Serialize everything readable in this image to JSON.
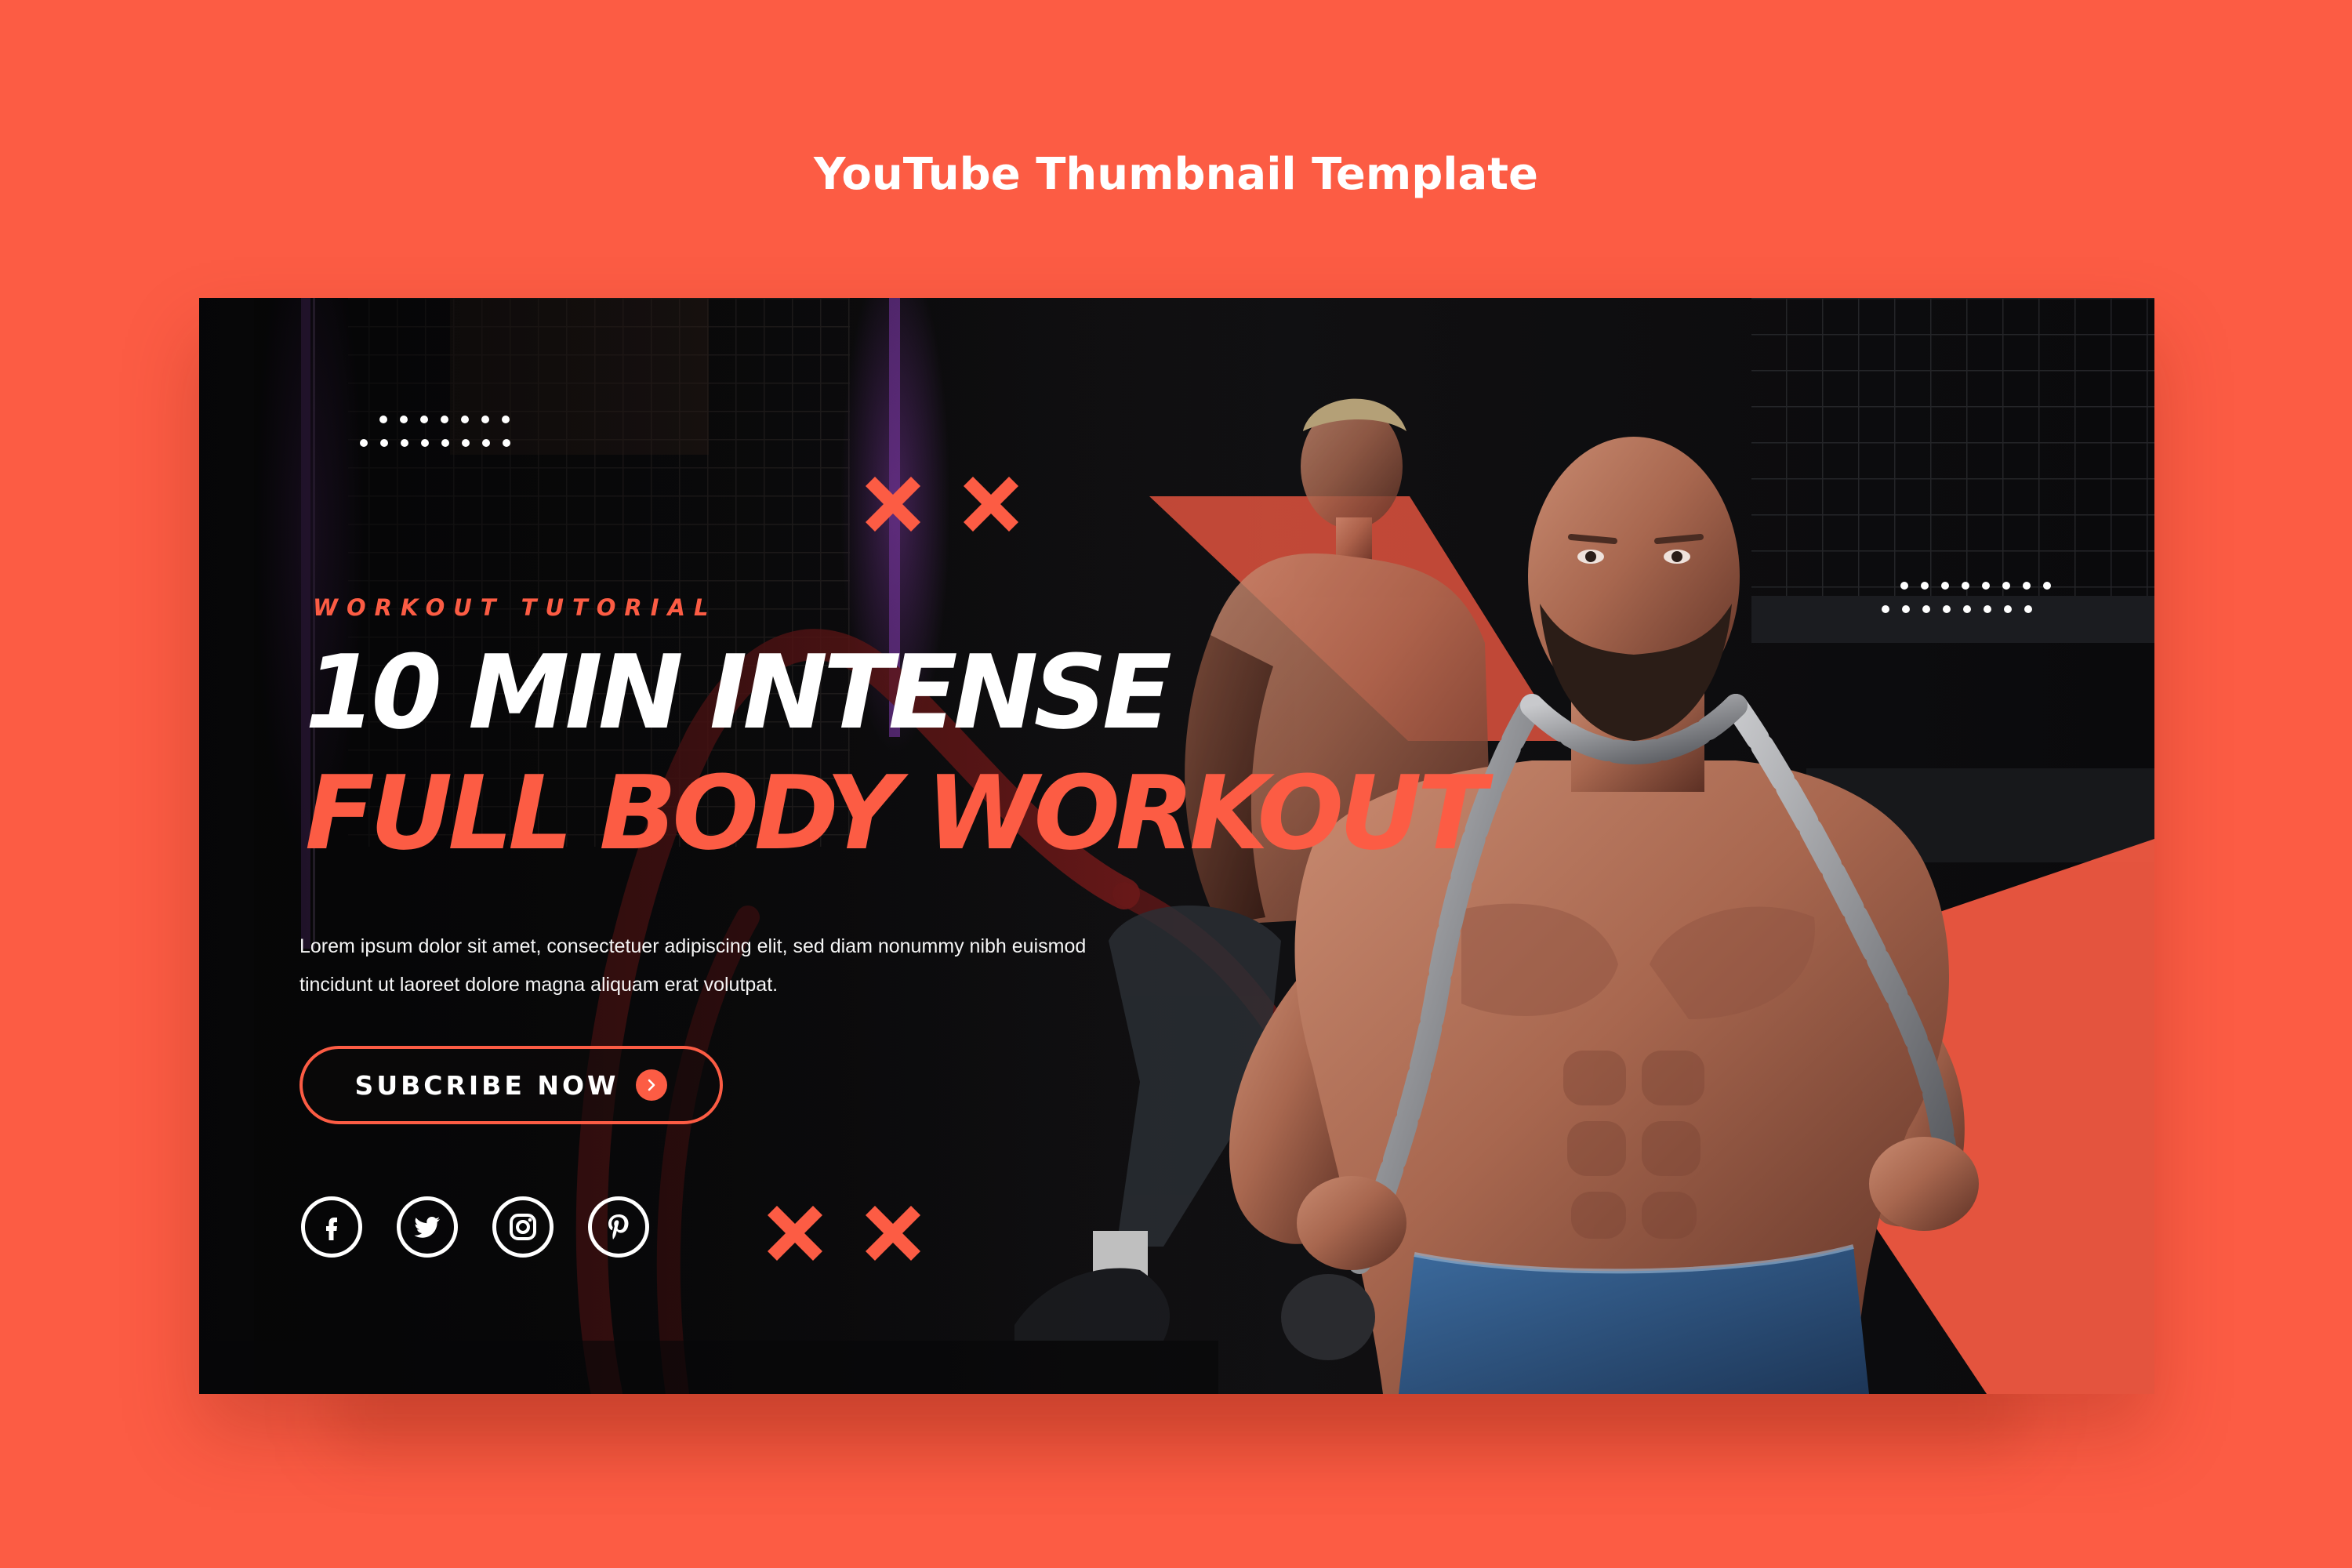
{
  "page": {
    "title": "YouTube Thumbnail Template",
    "background_color": "#fc5c44"
  },
  "thumbnail": {
    "eyebrow": "WORKOUT TUTORIAL",
    "headline_line_1": "10 MIN INTENSE",
    "headline_line_2": "FULL BODY WORKOUT",
    "body": "Lorem ipsum dolor sit amet, consectetuer adipiscing elit, sed diam nonummy nibh euismod tincidunt ut laoreet dolore magna aliquam erat volutpat.",
    "cta_label": "SUBCRIBE NOW",
    "cta_icon": "chevron-right-icon",
    "accent_color": "#fc5c44",
    "dark_color": "#0b0b0d",
    "social_icons": [
      "facebook-icon",
      "twitter-icon",
      "instagram-icon",
      "pinterest-icon"
    ]
  }
}
